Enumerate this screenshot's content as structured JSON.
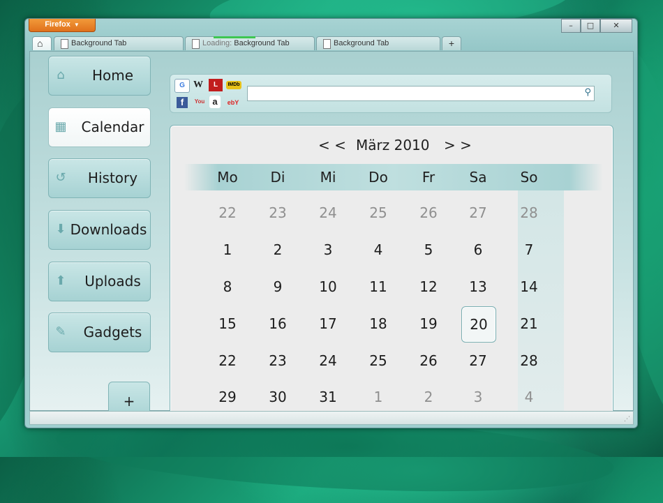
{
  "window": {
    "app_button": "Firefox",
    "controls": {
      "minimize": "–",
      "maximize": "□",
      "close": "✕"
    }
  },
  "tabs": [
    {
      "label": "Background Tab",
      "loading_prefix": ""
    },
    {
      "label": "Background Tab",
      "loading_prefix": "Loading:"
    },
    {
      "label": "Background Tab",
      "loading_prefix": ""
    }
  ],
  "new_tab_label": "+",
  "sidebar": {
    "items": [
      {
        "label": "Home",
        "icon": "home-icon",
        "glyph": "⌂"
      },
      {
        "label": "Calendar",
        "icon": "calendar-icon",
        "glyph": "▦"
      },
      {
        "label": "History",
        "icon": "history-icon",
        "glyph": "↺"
      },
      {
        "label": "Downloads",
        "icon": "download-icon",
        "glyph": "⬇"
      },
      {
        "label": "Uploads",
        "icon": "upload-icon",
        "glyph": "⬆"
      },
      {
        "label": "Gadgets",
        "icon": "wrench-icon",
        "glyph": "✎"
      }
    ],
    "add_label": "+"
  },
  "search": {
    "engines": [
      {
        "name": "google",
        "glyph": "G"
      },
      {
        "name": "wikipedia",
        "glyph": "W"
      },
      {
        "name": "leo",
        "glyph": "L"
      },
      {
        "name": "imdb",
        "glyph": "IMDb"
      },
      {
        "name": "facebook",
        "glyph": "f"
      },
      {
        "name": "youtube",
        "glyph": "You"
      },
      {
        "name": "amazon",
        "glyph": "a"
      },
      {
        "name": "ebay",
        "glyph": "ebY"
      }
    ],
    "value": "",
    "placeholder": ""
  },
  "calendar": {
    "prev_label": "< <",
    "next_label": "> >",
    "month_label": "März 2010",
    "weekdays": [
      "Mo",
      "Di",
      "Mi",
      "Do",
      "Fr",
      "Sa",
      "So"
    ],
    "weeks": [
      [
        "22",
        "23",
        "24",
        "25",
        "26",
        "27",
        "28"
      ],
      [
        "1",
        "2",
        "3",
        "4",
        "5",
        "6",
        "7"
      ],
      [
        "8",
        "9",
        "10",
        "11",
        "12",
        "13",
        "14"
      ],
      [
        "15",
        "16",
        "17",
        "18",
        "19",
        "20",
        "21"
      ],
      [
        "22",
        "23",
        "24",
        "25",
        "26",
        "27",
        "28"
      ],
      [
        "29",
        "30",
        "31",
        "1",
        "2",
        "3",
        "4"
      ]
    ],
    "today": "20"
  }
}
